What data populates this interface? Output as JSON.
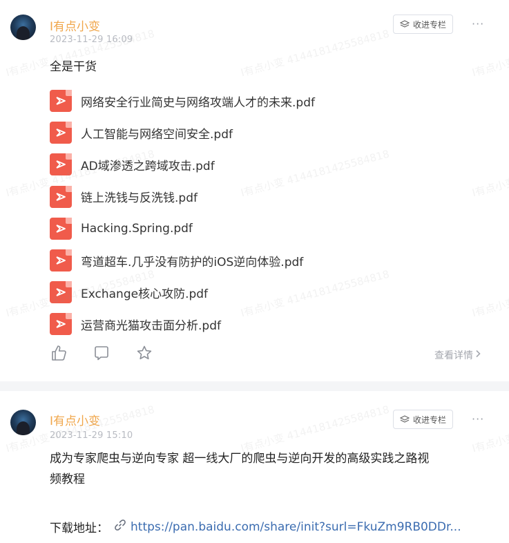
{
  "watermark": "I有点小变 4144181425584818",
  "posts": [
    {
      "author": "I有点小变",
      "time": "2023-11-29 16:09",
      "collect_label": "收进专栏",
      "more_label": "···",
      "text": "全是干货",
      "files": [
        "网络安全行业简史与网络攻端人才的未来.pdf",
        "人工智能与网络空间安全.pdf",
        "AD域渗透之跨域攻击.pdf",
        "链上洗钱与反洗钱.pdf",
        "Hacking.Spring.pdf",
        "弯道超车.几乎没有防护的iOS逆向体验.pdf",
        "Exchange核心攻防.pdf",
        "运营商光猫攻击面分析.pdf"
      ],
      "detail_label": "查看详情",
      "icons": [
        "thumbs-up-icon",
        "comment-icon",
        "star-icon",
        "pdf-icon",
        "chevron-right-icon"
      ]
    },
    {
      "author": "I有点小变",
      "time": "2023-11-29 15:10",
      "collect_label": "收进专栏",
      "more_label": "···",
      "text_line1": "成为专家爬虫与逆向专家  超一线大厂的爬虫与逆向开发的高级实践之路视",
      "text_line2": "频教程",
      "download_label": "下载地址：",
      "download_url": "https://pan.baidu.com/share/init?surl=FkuZm9RB0DDr..."
    }
  ],
  "colors": {
    "author": "#f0a64a",
    "time": "#b8bbc2",
    "pdf": "#f05b4b",
    "link": "#3b6cb0",
    "separator": "#f4f5f7"
  }
}
